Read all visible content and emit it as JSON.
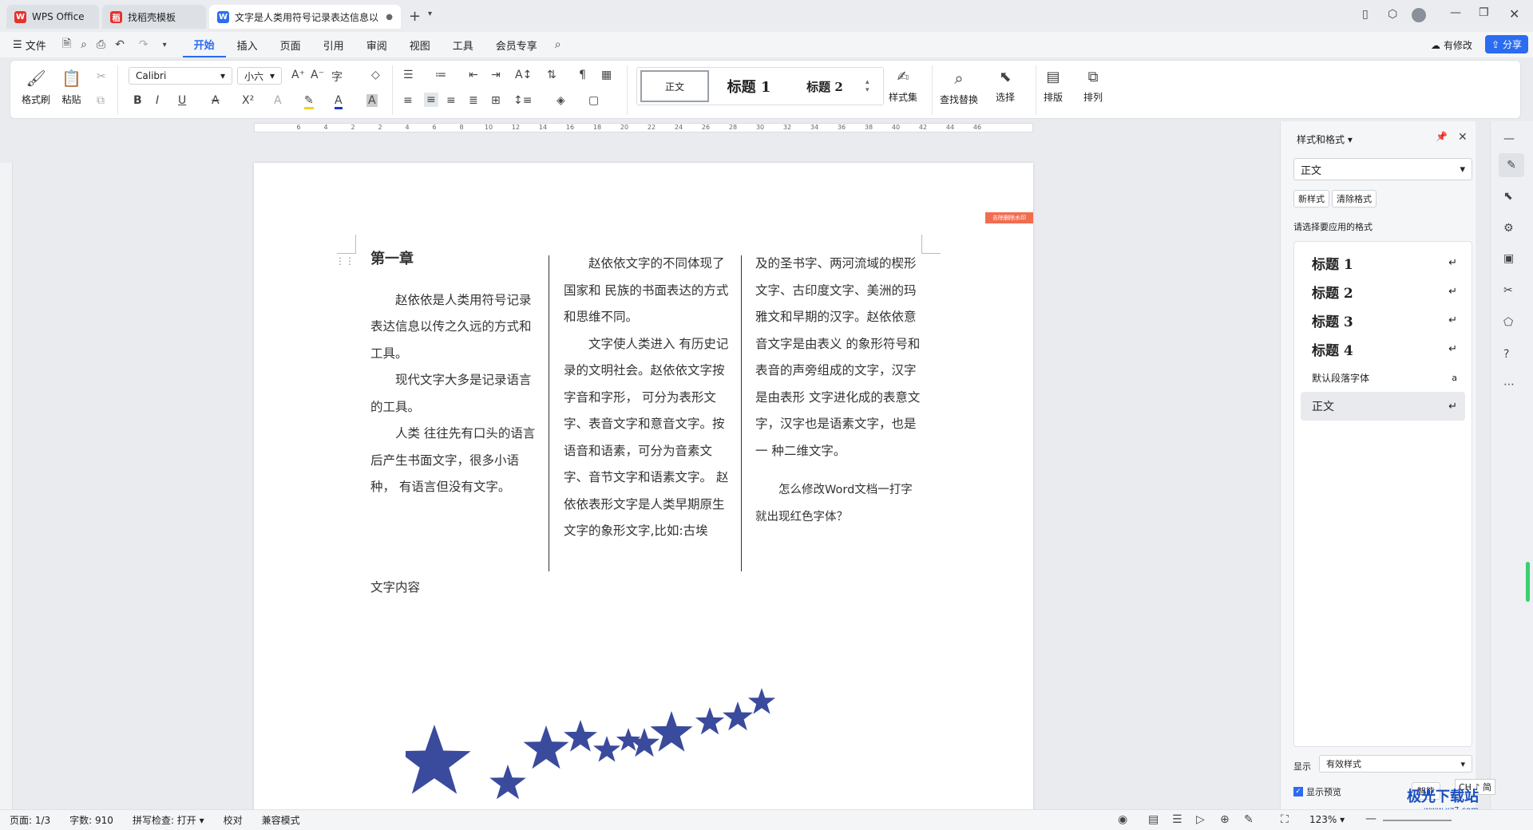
{
  "tabs": [
    {
      "label": "WPS Office",
      "icon": "wps-logo"
    },
    {
      "label": "找稻壳模板",
      "icon": "docer-logo"
    },
    {
      "label": "文字是人类用符号记录表达信息以",
      "icon": "word-logo"
    }
  ],
  "menu": {
    "file": "文件",
    "items": [
      "开始",
      "插入",
      "页面",
      "引用",
      "审阅",
      "视图",
      "工具",
      "会员专享"
    ],
    "active": "开始",
    "modified": "有修改",
    "share": "分享"
  },
  "ribbon": {
    "format_painter": "格式刷",
    "paste": "粘贴",
    "font_name": "Calibri",
    "font_size": "小六",
    "style_normal": "正文",
    "style_h1": "标题 1",
    "style_h2": "标题 2",
    "styles_set": "样式集",
    "find_replace": "查找替换",
    "select": "选择",
    "layout": "排版",
    "arrange": "排列"
  },
  "ruler_numbers": [
    "6",
    "4",
    "2",
    "2",
    "4",
    "6",
    "8",
    "10",
    "12",
    "14",
    "16",
    "18",
    "20",
    "22",
    "24",
    "26",
    "28",
    "30",
    "32",
    "34",
    "36",
    "38",
    "40",
    "42",
    "44",
    "46"
  ],
  "document": {
    "watermark_tag": "去除删除水印",
    "heading": "第一章",
    "col1": [
      "赵依依是人类用符号记录表达信息以传之久远的方式和工具。",
      "现代文字大多是记录语言的工具。",
      "人类 往往先有口头的语言后产生书面文字，很多小语种， 有语言但没有文字。"
    ],
    "col2": [
      "赵依依文字的不同体现了国家和 民族的书面表达的方式和思维不同。",
      "文字使人类进入 有历史记录的文明社会。赵依依文字按字音和字形， 可分为表形文字、表音文字和意音文字。按语音和语素，可分为音素文字、音节文字和语素文字。 赵依依表形文字是人类早期原生文字的象形文字,比如:古埃"
    ],
    "col3": [
      "及的圣书字、两河流域的楔形文字、古印度文字、美洲的玛雅文和早期的汉字。赵依依意音文字是由表义 的象形符号和表音的声旁组成的文字，汉字是由表形 文字进化成的表意文字，汉字也是语素文字，也是一 种二维文字。",
      "怎么修改Word文档一打字就出现红色字体？"
    ],
    "footer_text": "文字内容"
  },
  "style_panel": {
    "title": "样式和格式",
    "current_style": "正文",
    "new_style": "新样式",
    "clear_format": "清除格式",
    "prompt": "请选择要应用的格式",
    "styles": [
      "标题 1",
      "标题 2",
      "标题 3",
      "标题 4",
      "默认段落字体",
      "正文"
    ],
    "show_label": "显示",
    "show_value": "有效样式",
    "preview_label": "显示预览",
    "smart_label": "智能"
  },
  "ime": "CH ♪ 简",
  "statusbar": {
    "page": "页面: 1/3",
    "words": "字数: 910",
    "spell": "拼写检查: 打开",
    "proof": "校对",
    "compat": "兼容模式",
    "zoom": "123%"
  },
  "watermark_site": "极光下载站",
  "watermark_url": "www.xz7.com",
  "colors": {
    "accent": "#2b6cf0",
    "star": "#3a4a9c",
    "tag": "#f26c4f"
  }
}
